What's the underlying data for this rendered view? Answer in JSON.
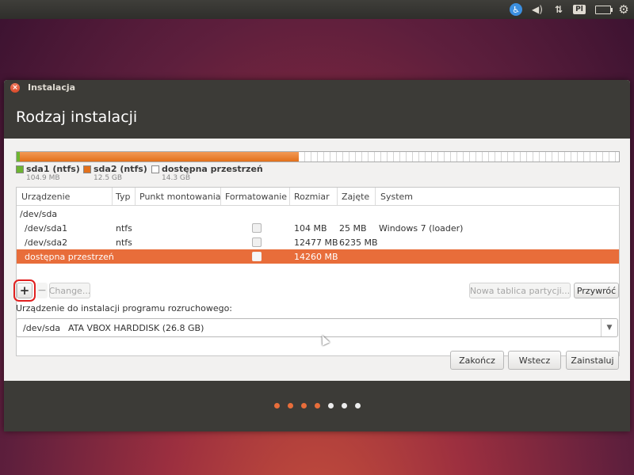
{
  "top_panel": {
    "keyboard_layout": "Pl",
    "icons": [
      "accessibility-icon",
      "volume-icon",
      "network-icon",
      "keyboard-layout-icon",
      "battery-icon",
      "settings-gear-icon"
    ]
  },
  "window": {
    "title": "Instalacja",
    "page_title": "Rodzaj instalacji"
  },
  "legend": [
    {
      "name": "sda1 (ntfs)",
      "size": "104.9 MB",
      "color": "#6db432"
    },
    {
      "name": "sda2 (ntfs)",
      "size": "12.5 GB",
      "color": "#e2701c"
    },
    {
      "name": "dostępna przestrzeń",
      "size": "14.3 GB",
      "color": "#ffffff"
    }
  ],
  "table": {
    "headers": [
      "Urządzenie",
      "Typ",
      "Punkt montowania",
      "Formatowanie",
      "Rozmiar",
      "Zajęte",
      "System"
    ],
    "rows": [
      {
        "device": "/dev/sda",
        "type": "",
        "mount": "",
        "format": "",
        "size": "",
        "used": "",
        "system": "",
        "is_disk": true
      },
      {
        "device": "/dev/sda1",
        "type": "ntfs",
        "mount": "",
        "format": false,
        "size": "104 MB",
        "used": "25 MB",
        "system": "Windows 7 (loader)"
      },
      {
        "device": "/dev/sda2",
        "type": "ntfs",
        "mount": "",
        "format": false,
        "size": "12477 MB",
        "used": "6235 MB",
        "system": ""
      },
      {
        "device": "dostępna przestrzeń",
        "type": "",
        "mount": "",
        "format": false,
        "size": "14260 MB",
        "used": "",
        "system": "",
        "selected": true
      }
    ]
  },
  "buttons": {
    "add": "+",
    "remove": "−",
    "change": "Change...",
    "new_table": "Nowa tablica partycji...",
    "revert": "Przywróć",
    "quit": "Zakończ",
    "back": "Wstecz",
    "install": "Zainstaluj"
  },
  "boot_loader": {
    "label": "Urządzenie do instalacji programu rozruchowego:",
    "device": "/dev/sda",
    "model": "ATA VBOX HARDDISK (26.8 GB)"
  },
  "progress": {
    "current_step": 4,
    "total_steps": 7
  },
  "colors": {
    "accent": "#e86d3a",
    "header": "#3c3b37"
  }
}
